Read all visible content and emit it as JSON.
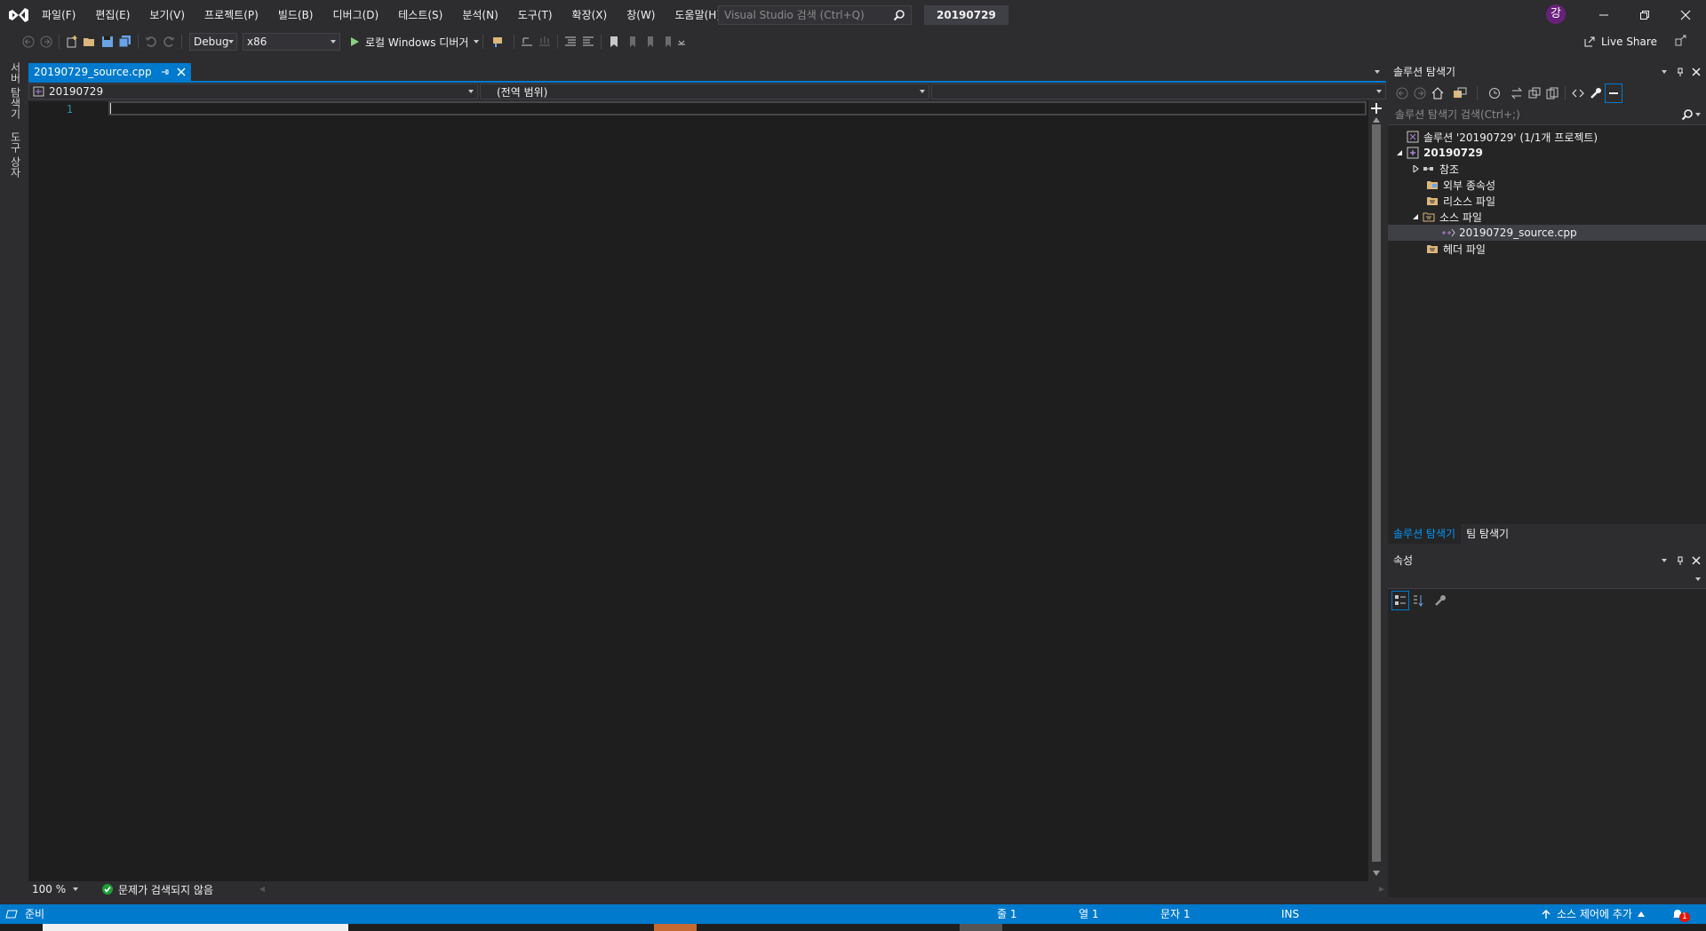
{
  "menu": {
    "items": [
      "파일(F)",
      "편집(E)",
      "보기(V)",
      "프로젝트(P)",
      "빌드(B)",
      "디버그(D)",
      "테스트(S)",
      "분석(N)",
      "도구(T)",
      "확장(X)",
      "창(W)",
      "도움말(H)"
    ],
    "search_placeholder": "Visual Studio 검색 (Ctrl+Q)",
    "solution_name": "20190729",
    "avatar_initial": "강"
  },
  "toolbar": {
    "config": "Debug",
    "platform": "x86",
    "run_label": "로컬 Windows 디버거",
    "live_share": "Live Share"
  },
  "left_tabs": [
    "서버 탐색기",
    "도구 상자"
  ],
  "editor": {
    "tab_title": "20190729_source.cpp",
    "nav_project": "20190729",
    "nav_scope": "(전역 범위)",
    "line_number": "1",
    "zoom": "100 %",
    "issues": "문제가 검색되지 않음"
  },
  "solution_explorer": {
    "title": "솔루션 탐색기",
    "search_placeholder": "솔루션 탐색기 검색(Ctrl+;)",
    "tree": {
      "solution": "솔루션 '20190729' (1/1개 프로젝트)",
      "project": "20190729",
      "references": "참조",
      "external_deps": "외부 종속성",
      "resource_files": "리소스 파일",
      "source_files": "소스 파일",
      "source_file": "20190729_source.cpp",
      "header_files": "헤더 파일"
    },
    "bottom_tabs": [
      "솔루션 탐색기",
      "팀 탐색기"
    ]
  },
  "properties": {
    "title": "속성"
  },
  "statusbar": {
    "ready": "준비",
    "line": "줄 1",
    "col": "열 1",
    "char": "문자 1",
    "mode": "INS",
    "source_control": "소스 제어에 추가",
    "notifications": "1"
  },
  "colors": {
    "accent": "#007acc",
    "background": "#2d2d30",
    "editor_bg": "#1e1e1e",
    "brand": "#68217a"
  }
}
